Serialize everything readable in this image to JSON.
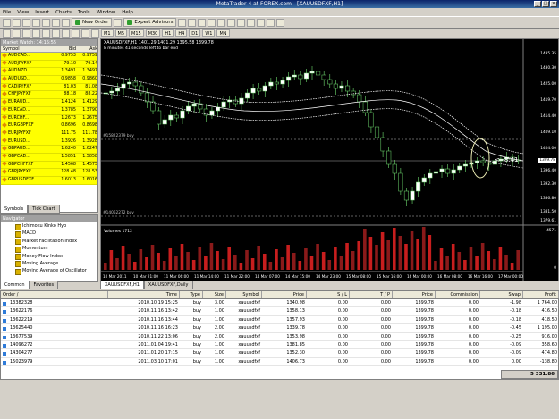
{
  "window": {
    "title": "MetaTrader 4 at FOREX.com - [XAUUSDFXF,H1]"
  },
  "menu": [
    "File",
    "View",
    "Insert",
    "Charts",
    "Tools",
    "Window",
    "Help"
  ],
  "toolbar": {
    "new_order": "New Order",
    "expert_advisors": "Expert Advisors"
  },
  "timeframes": [
    "M1",
    "M5",
    "M15",
    "M30",
    "H1",
    "H4",
    "D1",
    "W1",
    "MN"
  ],
  "market_watch": {
    "header": "Market Watch: 14:15:55",
    "columns": [
      "Symbol",
      "Bid",
      "Ask"
    ],
    "rows": [
      {
        "symbol": "AUDCAD...",
        "bid": "0.9753",
        "ask": "0.9759"
      },
      {
        "symbol": "AUDJPYFXF",
        "bid": "79.10",
        "ask": "79.14"
      },
      {
        "symbol": "AUDNZD...",
        "bid": "1.3491",
        "ask": "1.3497"
      },
      {
        "symbol": "AUDUSD...",
        "bid": "0.9858",
        "ask": "0.9860"
      },
      {
        "symbol": "CADJPYFXF",
        "bid": "81.03",
        "ask": "81.08"
      },
      {
        "symbol": "CHFJPYFXF",
        "bid": "88.18",
        "ask": "88.22"
      },
      {
        "symbol": "EURAUD...",
        "bid": "1.4124",
        "ask": "1.4129"
      },
      {
        "symbol": "EURCAD...",
        "bid": "1.3785",
        "ask": "1.3790"
      },
      {
        "symbol": "EURCHF...",
        "bid": "1.2673",
        "ask": "1.2675"
      },
      {
        "symbol": "EURGBPFXF",
        "bid": "0.8696",
        "ask": "0.8698"
      },
      {
        "symbol": "EURJPYFXF",
        "bid": "111.75",
        "ask": "111.78"
      },
      {
        "symbol": "EURUSD...",
        "bid": "1.3926",
        "ask": "1.3928"
      },
      {
        "symbol": "GBPAUD...",
        "bid": "1.6240",
        "ask": "1.6247"
      },
      {
        "symbol": "GBPCAD...",
        "bid": "1.5851",
        "ask": "1.5858"
      },
      {
        "symbol": "GBPCHFFXF",
        "bid": "1.4568",
        "ask": "1.4575"
      },
      {
        "symbol": "GBPJPYFXF",
        "bid": "128.48",
        "ask": "128.53"
      },
      {
        "symbol": "GBPUSDFXF",
        "bid": "1.6013",
        "ask": "1.6016"
      }
    ],
    "tabs": [
      "Symbols",
      "Tick Chart"
    ]
  },
  "navigator": {
    "header": "Navigator",
    "items": [
      "Ichimoku Kinko Hyo",
      "MACD",
      "Market Facilitation Index",
      "Momentum",
      "Money Flow Index",
      "Moving Average",
      "Moving Average of Oscillator"
    ],
    "tabs": [
      "Common",
      "Favorites"
    ]
  },
  "chart": {
    "title": "XAUUSDFXF,H1  1401.29 1401.29 1395.58 1399.78",
    "subtitle": "8 minutes 41 seconds left to bar end",
    "countdown": "<--8:41",
    "volume_label": "Volumes 1712",
    "line1_label": "#15822379 buy",
    "line2_label": "#14062272 buy",
    "price_labels": [
      "1435.35",
      "1430.30",
      "1425.00",
      "1419.70",
      "1414.40",
      "1409.10",
      "1404.00",
      "1399.78",
      "1396.40",
      "1392.30",
      "1386.80",
      "1381.50",
      "1379.61",
      "4571",
      "0"
    ],
    "x_labels": [
      "10 Mar 2011",
      "10 Mar 21:00",
      "11 Mar 06:00",
      "11 Mar 14:00",
      "11 Mar 22:00",
      "14 Mar 07:00",
      "14 Mar 15:00",
      "14 Mar 23:00",
      "15 Mar 08:00",
      "15 Mar 16:00",
      "16 Mar 00:00",
      "16 Mar 08:00",
      "16 Mar 16:00",
      "17 Mar 00:00"
    ],
    "tabs": [
      "XAUUSDFXF,H1",
      "XAUUSDFXF,Daily"
    ]
  },
  "terminal": {
    "columns": [
      "Order  /",
      "Time",
      "Type",
      "Size",
      "Symbol",
      "Price",
      "S / L",
      "T / P",
      "Price",
      "Commission",
      "Swap",
      "Profit"
    ],
    "rows": [
      [
        "13382328",
        "2010.10.19 15:25",
        "buy",
        "3.00",
        "xauusdfxf",
        "1340.98",
        "0.00",
        "0.00",
        "1399.78",
        "0.00",
        "-1.98",
        "1 764.00"
      ],
      [
        "13622176",
        "2010.11.16 13:42",
        "buy",
        "1.00",
        "xauusdfxf",
        "1358.13",
        "0.00",
        "0.00",
        "1399.78",
        "0.00",
        "-0.18",
        "416.50"
      ],
      [
        "13622219",
        "2010.11.16 13:44",
        "buy",
        "1.00",
        "xauusdfxf",
        "1357.93",
        "0.00",
        "0.00",
        "1399.78",
        "0.00",
        "-0.18",
        "418.50"
      ],
      [
        "13625440",
        "2010.11.16 16:23",
        "buy",
        "2.00",
        "xauusdfxf",
        "1339.78",
        "0.00",
        "0.00",
        "1399.78",
        "0.00",
        "-0.45",
        "1 195.00"
      ],
      [
        "13677539",
        "2010.11.22 13:06",
        "buy",
        "2.00",
        "xauusdfxf",
        "1353.98",
        "0.00",
        "0.00",
        "1399.78",
        "0.00",
        "-0.25",
        "916.00"
      ],
      [
        "14096272",
        "2011.01.04 19:41",
        "buy",
        "1.00",
        "xauusdfxf",
        "1381.85",
        "0.00",
        "0.00",
        "1399.78",
        "0.00",
        "-0.09",
        "358.60"
      ],
      [
        "14304277",
        "2011.01.20 17:15",
        "buy",
        "1.00",
        "xauusdfxf",
        "1352.30",
        "0.00",
        "0.00",
        "1399.78",
        "0.00",
        "-0.09",
        "474.80"
      ],
      [
        "15023979",
        "2011.03.10 17:01",
        "buy",
        "1.00",
        "xauusdfxf",
        "1406.73",
        "0.00",
        "0.00",
        "1399.78",
        "0.00",
        "0.00",
        "-138.80"
      ]
    ],
    "total": "5 331.86"
  }
}
